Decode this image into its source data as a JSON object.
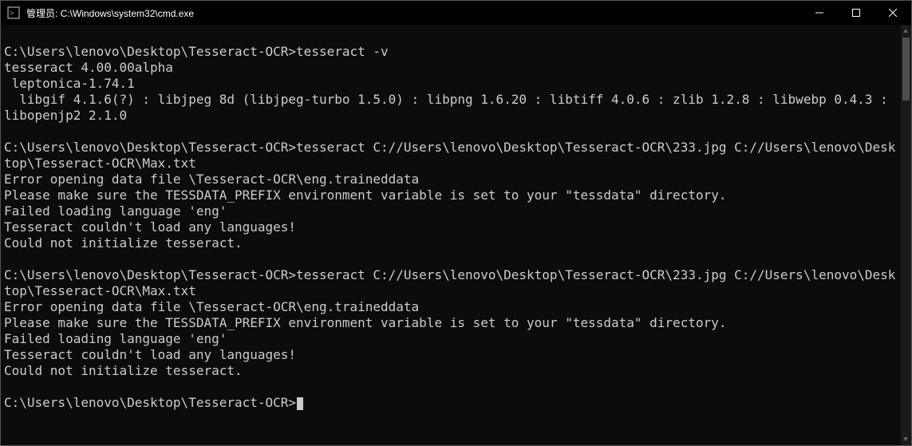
{
  "titlebar": {
    "title": "管理员: C:\\Windows\\system32\\cmd.exe"
  },
  "prompt_path": "C:\\Users\\lenovo\\Desktop\\Tesseract-OCR>",
  "blocks": [
    {
      "prompt": "C:\\Users\\lenovo\\Desktop\\Tesseract-OCR>",
      "cmd": "tesseract -v",
      "out": [
        "tesseract 4.00.00alpha",
        " leptonica-1.74.1",
        "  libgif 4.1.6(?) : libjpeg 8d (libjpeg-turbo 1.5.0) : libpng 1.6.20 : libtiff 4.0.6 : zlib 1.2.8 : libwebp 0.4.3 : libopenjp2 2.1.0"
      ]
    },
    {
      "prompt": "C:\\Users\\lenovo\\Desktop\\Tesseract-OCR>",
      "cmd": "tesseract C://Users\\lenovo\\Desktop\\Tesseract-OCR\\233.jpg C://Users\\lenovo\\Desktop\\Tesseract-OCR\\Max.txt",
      "out": [
        "Error opening data file \\Tesseract-OCR\\eng.traineddata",
        "Please make sure the TESSDATA_PREFIX environment variable is set to your \"tessdata\" directory.",
        "Failed loading language 'eng'",
        "Tesseract couldn't load any languages!",
        "Could not initialize tesseract."
      ]
    },
    {
      "prompt": "C:\\Users\\lenovo\\Desktop\\Tesseract-OCR>",
      "cmd": "tesseract C://Users\\lenovo\\Desktop\\Tesseract-OCR\\233.jpg C://Users\\lenovo\\Desktop\\Tesseract-OCR\\Max.txt",
      "out": [
        "Error opening data file \\Tesseract-OCR\\eng.traineddata",
        "Please make sure the TESSDATA_PREFIX environment variable is set to your \"tessdata\" directory.",
        "Failed loading language 'eng'",
        "Tesseract couldn't load any languages!",
        "Could not initialize tesseract."
      ]
    }
  ],
  "final_prompt": "C:\\Users\\lenovo\\Desktop\\Tesseract-OCR>",
  "scrollbar": {
    "thumb_top_pct": 0,
    "thumb_height_pct": 16
  }
}
